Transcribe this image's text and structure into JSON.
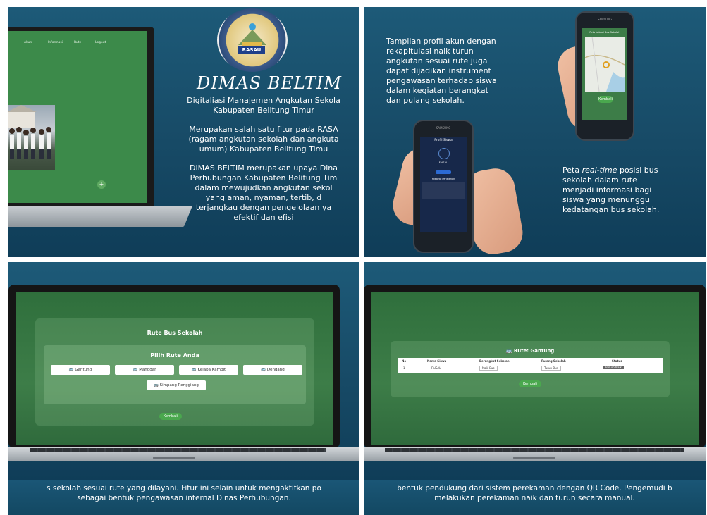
{
  "panel1": {
    "logo_text": "RASAU",
    "title": "DIMAS BELTIM",
    "laptop_nav": [
      "Akun",
      "Informasi",
      "Rute",
      "Logout"
    ],
    "laptop_fab": "+",
    "paragraphs": [
      [
        "Digitaliasi Manajemen Angkutan Sekola",
        "Kabupaten Belitung Timur"
      ],
      [
        "Merupakan salah satu fitur pada RASA",
        "(ragam angkutan sekolah dan angkuta",
        "umum) Kabupaten Belitung Timu"
      ],
      [
        "DIMAS BELTIM merupakan upaya Dina",
        "Perhubungan Kabupaten Belitung Tim",
        "dalam mewujudkan angkutan sekol",
        "yang aman, nyaman, tertib, d",
        "terjangkau dengan pengelolaan ya",
        "efektif dan efisi"
      ]
    ]
  },
  "panel2": {
    "text_top": [
      "Tampilan profil akun dengan",
      "rekapitulasi naik turun",
      "angkutan sesuai rute juga",
      "dapat dijadikan instrument",
      "pengawasan terhadap siswa",
      "dalam kegiatan berangkat",
      "dan pulang sekolah."
    ],
    "text_bottom_prefix": "Peta ",
    "text_bottom_italic": "real-time",
    "text_bottom_rest_first": " posisi bus",
    "text_bottom": [
      "sekolah dalam rute",
      "menjadi informasi bagi",
      "siswa yang menunggu",
      "kedatangan bus sekolah."
    ],
    "phone_brand": "SAMSUNG",
    "map_phone_header": "Peta Lokasi Bus Sekolah",
    "map_phone_button": "Kembali",
    "profile_phone_header": "Profil Siswa",
    "profile_name": "FAISAL",
    "profile_section": "Riwayat Perjalanan"
  },
  "panel3": {
    "card_title": "Rute Bus Sekolah",
    "sub_title": "Pilih Rute Anda",
    "routes": [
      "Gantung",
      "Manggar",
      "Kelapa Kampit",
      "Dendang",
      "Simpang Renggiang"
    ],
    "back_button": "Kembali"
  },
  "panel4": {
    "card_title": "Rute: Gantung",
    "columns": [
      "No",
      "Nama Siswa",
      "Berangkat Sekolah",
      "Pulang Sekolah",
      "Status"
    ],
    "row": [
      "1",
      "FAISAL",
      "Naik Bus",
      "Turun Bus",
      "Belum Naik"
    ],
    "back_button": "Kembali"
  },
  "captions": {
    "panel3": [
      "s sekolah sesuai rute yang dilayani. Fitur ini selain untuk mengaktifkan po",
      "sebagai bentuk pengawasan internal Dinas Perhubungan."
    ],
    "panel4": [
      "bentuk pendukung dari sistem perekaman dengan QR Code. Pengemudi b",
      "melakukan perekaman naik dan turun secara manual."
    ]
  },
  "colors": {
    "background_blue": "#174a66",
    "screen_green": "#3c8a4a",
    "button_green": "#4aa84e"
  }
}
